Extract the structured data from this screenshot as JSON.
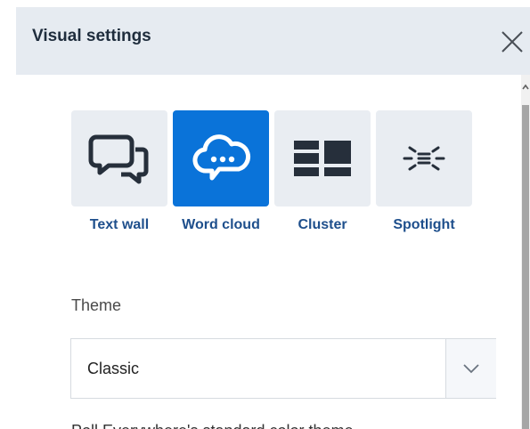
{
  "panel": {
    "title": "Visual settings",
    "close_icon": "close-icon"
  },
  "modes": [
    {
      "label": "Text wall",
      "icon": "speech-bubbles-icon",
      "selected": false
    },
    {
      "label": "Word cloud",
      "icon": "cloud-chat-icon",
      "selected": true
    },
    {
      "label": "Cluster",
      "icon": "cluster-icon",
      "selected": false
    },
    {
      "label": "Spotlight",
      "icon": "spotlight-icon",
      "selected": false
    }
  ],
  "theme": {
    "label": "Theme",
    "selected": "Classic",
    "description": "Poll Everywhere's standard color theme"
  },
  "colors": {
    "header_bg": "#e6ebf1",
    "accent": "#0a73d9",
    "tile_bg": "#e9edf2",
    "label_blue": "#1e4f8c",
    "icon_dark": "#262f3b"
  }
}
